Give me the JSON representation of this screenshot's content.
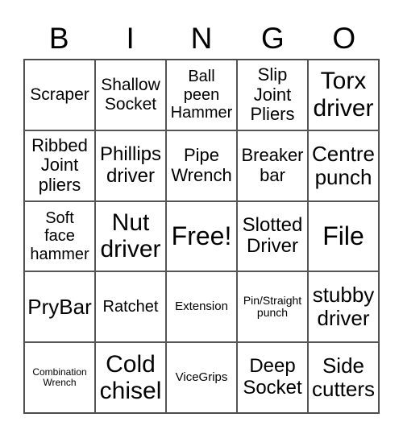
{
  "header": [
    "B",
    "I",
    "N",
    "G",
    "O"
  ],
  "cells": [
    "Scraper",
    "Shallow Socket",
    "Ball peen Hammer",
    "Slip Joint Pliers",
    "Torx driver",
    "Ribbed Joint pliers",
    "Phillips driver",
    "Pipe Wrench",
    "Breaker bar",
    "Centre punch",
    "Soft face hammer",
    "Nut driver",
    "Free!",
    "Slotted Driver",
    "File",
    "PryBar",
    "Ratchet",
    "Extension",
    "Pin/Straight punch",
    "stubby driver",
    "Combination Wrench",
    "Cold chisel",
    "ViceGrips",
    "Deep Socket",
    "Side cutters"
  ]
}
